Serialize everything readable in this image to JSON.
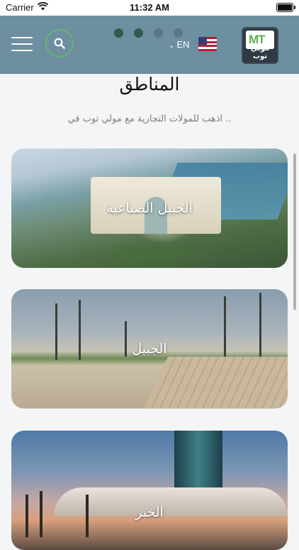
{
  "status_bar": {
    "carrier": "Carrier",
    "time": "11:32 AM"
  },
  "header": {
    "menu_icon": "hamburger-menu-icon",
    "search_icon": "search-icon",
    "carousel_dots": {
      "count": 4,
      "active": [
        0,
        1
      ]
    },
    "language": "EN",
    "flag_icon": "us-flag-icon",
    "logo_text": "مولي توب"
  },
  "section": {
    "title": "المناطق",
    "subtitle": "اذهب للمولات التجارية مع مولي توب في .."
  },
  "regions": [
    {
      "label": "الجبيل الصناعية"
    },
    {
      "label": "الجبيل"
    },
    {
      "label": "الخبر"
    }
  ],
  "colors": {
    "header_bg": "#6d8fa0",
    "accent_green": "#64b56e",
    "active_dot": "#2c5b4f"
  }
}
